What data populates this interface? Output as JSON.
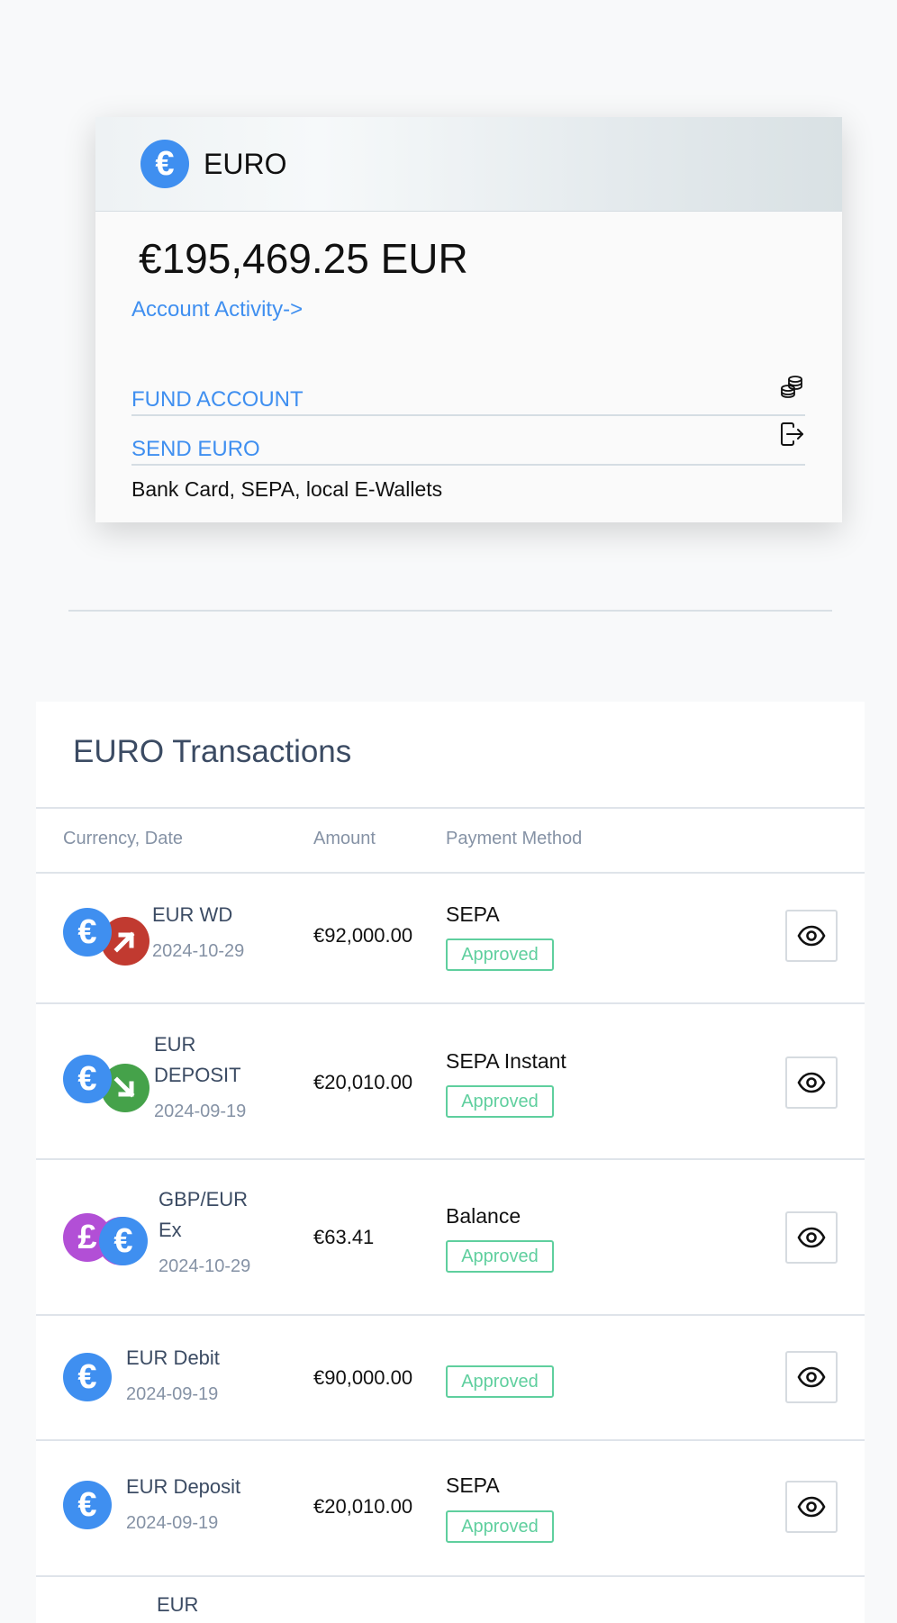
{
  "account": {
    "currency_symbol": "€",
    "title": "EURO",
    "balance": "€195,469.25 EUR",
    "activity_link": "Account Activity->",
    "fund_label": "FUND ACCOUNT",
    "send_label": "SEND EURO",
    "methods_note": "Bank Card, SEPA, local E-Wallets"
  },
  "transactions": {
    "title": "EURO Transactions",
    "columns": [
      "Currency, Date",
      "Amount",
      "Payment Method"
    ],
    "rows": [
      {
        "name": "EUR WD",
        "date": "2024-10-29",
        "amount": "€92,000.00",
        "method": "SEPA",
        "status": "Approved",
        "primary_symbol": "€",
        "secondary_symbol": "↗"
      },
      {
        "name": "EUR DEPOSIT",
        "date": "2024-09-19",
        "amount": "€20,010.00",
        "method": "SEPA Instant",
        "status": "Approved",
        "primary_symbol": "€",
        "secondary_symbol": "↘"
      },
      {
        "name": "GBP/EUR Ex",
        "date": "2024-10-29",
        "amount": "€63.41",
        "method": "Balance",
        "status": "Approved",
        "primary_symbol": "£",
        "secondary_symbol": "€"
      },
      {
        "name": "EUR Debit",
        "date": "2024-09-19",
        "amount": "€90,000.00",
        "method": "",
        "status": "Approved",
        "primary_symbol": "€"
      },
      {
        "name": "EUR Deposit",
        "date": "2024-09-19",
        "amount": "€20,010.00",
        "method": "SEPA",
        "status": "Approved",
        "primary_symbol": "€"
      },
      {
        "name": "EUR"
      }
    ]
  },
  "icons": {
    "currency": "euro-coin-icon",
    "fund": "coins-stack-icon",
    "send": "logout-arrow-icon",
    "view": "eye-icon",
    "withdrawal": "arrow-up-right-icon",
    "deposit": "arrow-down-right-icon"
  },
  "colors": {
    "accent": "#3f8ff0",
    "withdrawal": "#c13a30",
    "deposit": "#45a24a",
    "gbp": "#b24fd6",
    "approved": "#5fcf9e"
  }
}
